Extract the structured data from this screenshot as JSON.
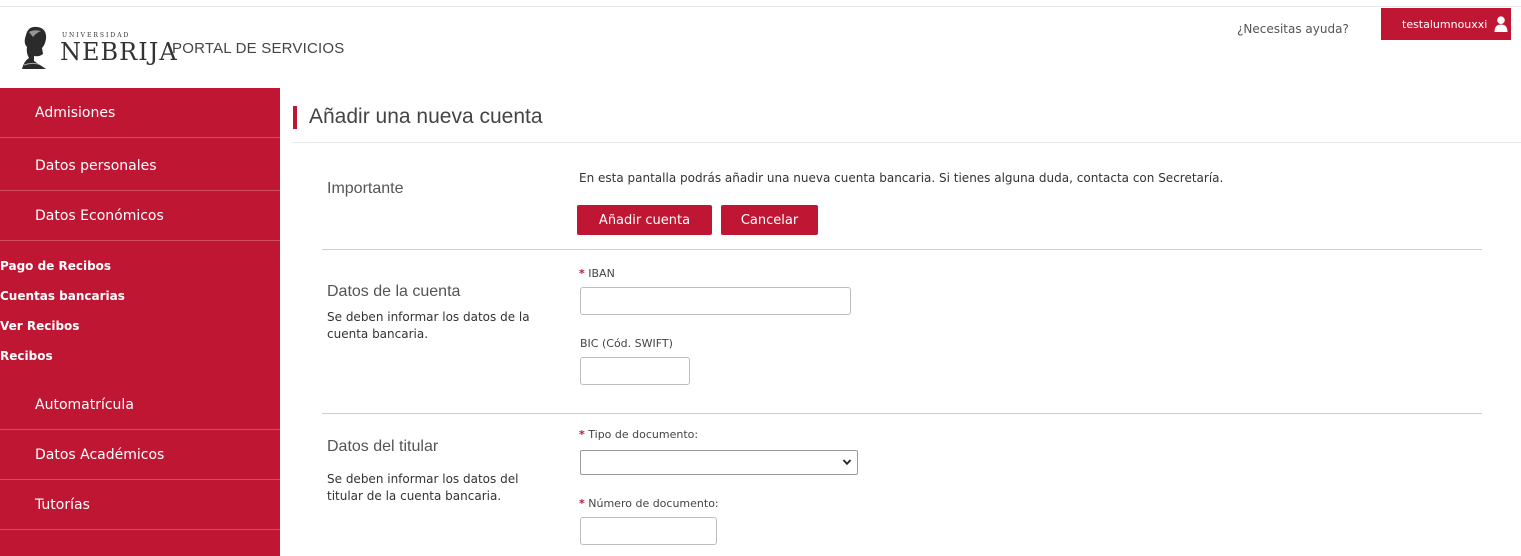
{
  "header": {
    "logo_small": "UNIVERSIDAD",
    "logo_big": "NEBRIJA",
    "portal_title": "PORTAL DE SERVICIOS",
    "help_link": "¿Necesitas ayuda?",
    "username": "testalumnouxxi",
    "user_icon": "user-icon"
  },
  "colors": {
    "brand_red": "#bf1733",
    "sidebar_divider": "#d04d60"
  },
  "sidebar": {
    "items": [
      {
        "label": "Admisiones"
      },
      {
        "label": "Datos personales"
      },
      {
        "label": "Datos Económicos"
      },
      {
        "label": "Automatrícula"
      },
      {
        "label": "Datos Académicos"
      },
      {
        "label": "Tutorías"
      }
    ],
    "subitems": [
      {
        "label": "Pago de Recibos"
      },
      {
        "label": "Cuentas bancarias"
      },
      {
        "label": "Ver Recibos"
      },
      {
        "label": "Recibos"
      }
    ]
  },
  "main": {
    "title": "Añadir una nueva cuenta",
    "important": {
      "title": "Importante",
      "text": "En esta pantalla podrás añadir una nueva cuenta bancaria. Si tienes alguna duda, contacta con Secretaría.",
      "add_button": "Añadir cuenta",
      "cancel_button": "Cancelar"
    },
    "account": {
      "title": "Datos de la cuenta",
      "description": "Se deben informar los datos de la cuenta bancaria.",
      "iban_required": "*",
      "iban_label": "IBAN",
      "iban_value": "",
      "bic_label": "BIC (Cód. SWIFT)",
      "bic_value": ""
    },
    "holder": {
      "title": "Datos del titular",
      "description": "Se deben informar los datos del titular de la cuenta bancaria.",
      "doc_type_required": "*",
      "doc_type_label": "Tipo de documento:",
      "doc_type_value": "",
      "doc_number_required": "*",
      "doc_number_label": "Número de documento:",
      "doc_number_value": ""
    }
  }
}
